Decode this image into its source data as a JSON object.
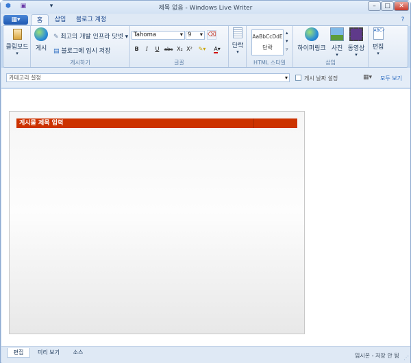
{
  "window": {
    "title": "제목 없음 - Windows Live Writer"
  },
  "tabs": [
    "홈",
    "삽입",
    "블로그 계정"
  ],
  "ribbon": {
    "clipboard": {
      "label": "클립보드"
    },
    "publish": {
      "publish_label": "게시",
      "group_label": "게시하기",
      "item1": "최고의 개발 인프라 닷넷",
      "item2": "블로그에 임시 저장"
    },
    "font": {
      "family": "Tahoma",
      "size": "9",
      "group_label": "글꼴",
      "bold": "B",
      "italic": "I",
      "underline": "U",
      "strike": "abc",
      "subscript": "X₂",
      "superscript": "X²",
      "color": "A"
    },
    "paragraph": {
      "label": "단락"
    },
    "style": {
      "preview": "AaBbCcDdE",
      "name": "단락",
      "group_label": "HTML 스타일"
    },
    "insert": {
      "hyperlink": "하이퍼링크",
      "photo": "사진",
      "video": "동영상",
      "group_label": "삽입"
    },
    "edit": {
      "label": "편집"
    }
  },
  "category": {
    "placeholder": "카테고리 설정",
    "date_label": "게시 날짜 설정",
    "view_all": "모두 보기"
  },
  "editor": {
    "title_placeholder": "게시물 제목 입력"
  },
  "bottom_tabs": [
    "편집",
    "미리 보기",
    "소스"
  ],
  "status": "임시본 - 저장 안 됨"
}
